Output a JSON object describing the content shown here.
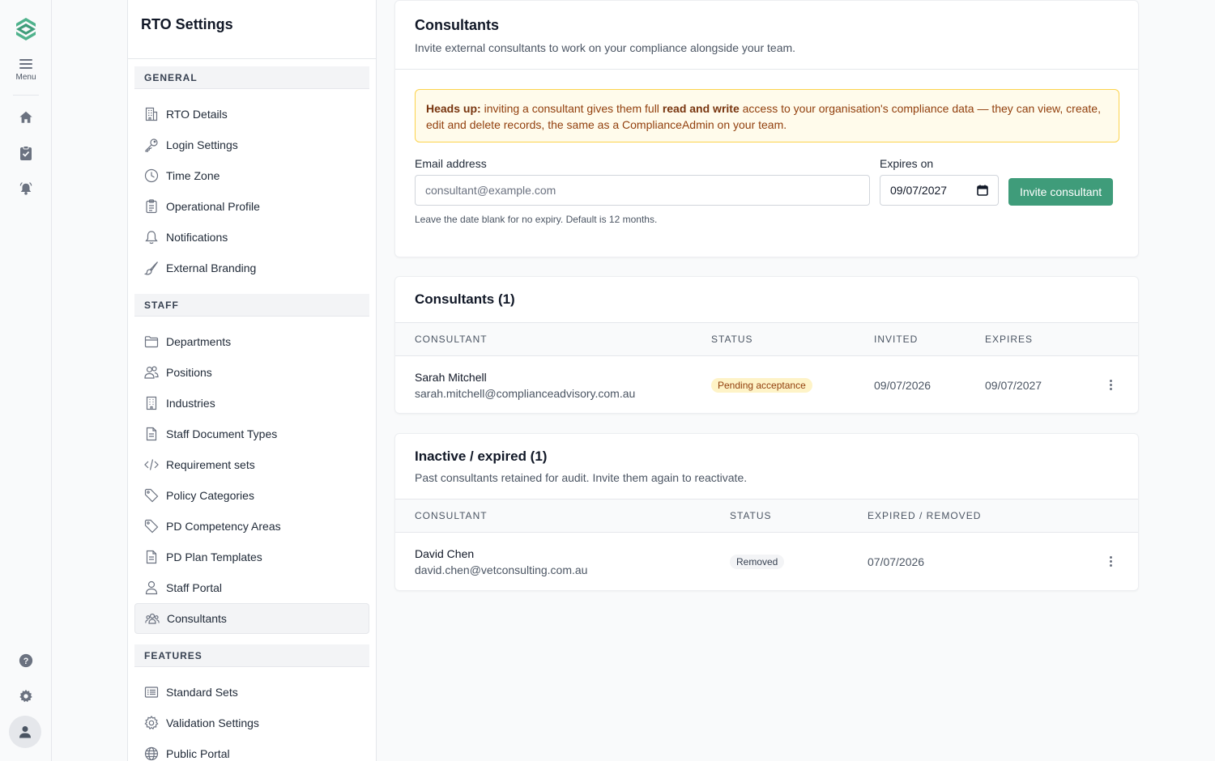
{
  "rail": {
    "menu_label": "Menu"
  },
  "settings": {
    "title": "RTO Settings",
    "sections": [
      {
        "label": "GENERAL",
        "items": [
          {
            "label": "RTO Details",
            "icon": "building-icon"
          },
          {
            "label": "Login Settings",
            "icon": "key-icon"
          },
          {
            "label": "Time Zone",
            "icon": "clock-icon"
          },
          {
            "label": "Operational Profile",
            "icon": "clipboard-icon"
          },
          {
            "label": "Notifications",
            "icon": "bell-icon"
          },
          {
            "label": "External Branding",
            "icon": "brush-icon"
          }
        ]
      },
      {
        "label": "STAFF",
        "items": [
          {
            "label": "Departments",
            "icon": "folder-icon"
          },
          {
            "label": "Positions",
            "icon": "users-icon"
          },
          {
            "label": "Industries",
            "icon": "office-icon"
          },
          {
            "label": "Staff Document Types",
            "icon": "document-icon"
          },
          {
            "label": "Requirement sets",
            "icon": "code-icon"
          },
          {
            "label": "Policy Categories",
            "icon": "tag-icon"
          },
          {
            "label": "PD Competency Areas",
            "icon": "tag-icon"
          },
          {
            "label": "PD Plan Templates",
            "icon": "document-icon"
          },
          {
            "label": "Staff Portal",
            "icon": "user-icon"
          },
          {
            "label": "Consultants",
            "icon": "user-group-icon",
            "active": true
          }
        ]
      },
      {
        "label": "FEATURES",
        "items": [
          {
            "label": "Standard Sets",
            "icon": "list-icon"
          },
          {
            "label": "Validation Settings",
            "icon": "gear-icon"
          },
          {
            "label": "Public Portal",
            "icon": "globe-icon"
          }
        ]
      }
    ]
  },
  "invite": {
    "title": "Consultants",
    "subtitle": "Invite external consultants to work on your compliance alongside your team.",
    "notice_strong": "Heads up:",
    "notice_part1": " inviting a consultant gives them full ",
    "notice_strong2": "read and write",
    "notice_part2": " access to your organisation's compliance data — they can view, create, edit and delete records, the same as a ComplianceAdmin on your team.",
    "email_label": "Email address",
    "email_placeholder": "consultant@example.com",
    "email_value": "",
    "expires_label": "Expires on",
    "expires_value": "09/07/2027",
    "button_label": "Invite consultant",
    "hint": "Leave the date blank for no expiry. Default is 12 months."
  },
  "active": {
    "title": "Consultants (1)",
    "headers": [
      "CONSULTANT",
      "STATUS",
      "INVITED",
      "EXPIRES"
    ],
    "rows": [
      {
        "name": "Sarah Mitchell",
        "email": "sarah.mitchell@complianceadvisory.com.au",
        "status": "Pending acceptance",
        "invited": "09/07/2026",
        "expires": "09/07/2027"
      }
    ]
  },
  "inactive": {
    "title": "Inactive / expired (1)",
    "subtitle": "Past consultants retained for audit. Invite them again to reactivate.",
    "headers": [
      "CONSULTANT",
      "STATUS",
      "EXPIRED / REMOVED"
    ],
    "rows": [
      {
        "name": "David Chen",
        "email": "david.chen@vetconsulting.com.au",
        "status": "Removed",
        "date": "07/07/2026"
      }
    ]
  },
  "colors": {
    "brand": "#3f9c7a",
    "warning_bg": "#fffbeb",
    "warning_border": "#fcd34d",
    "warning_text": "#92400e"
  }
}
